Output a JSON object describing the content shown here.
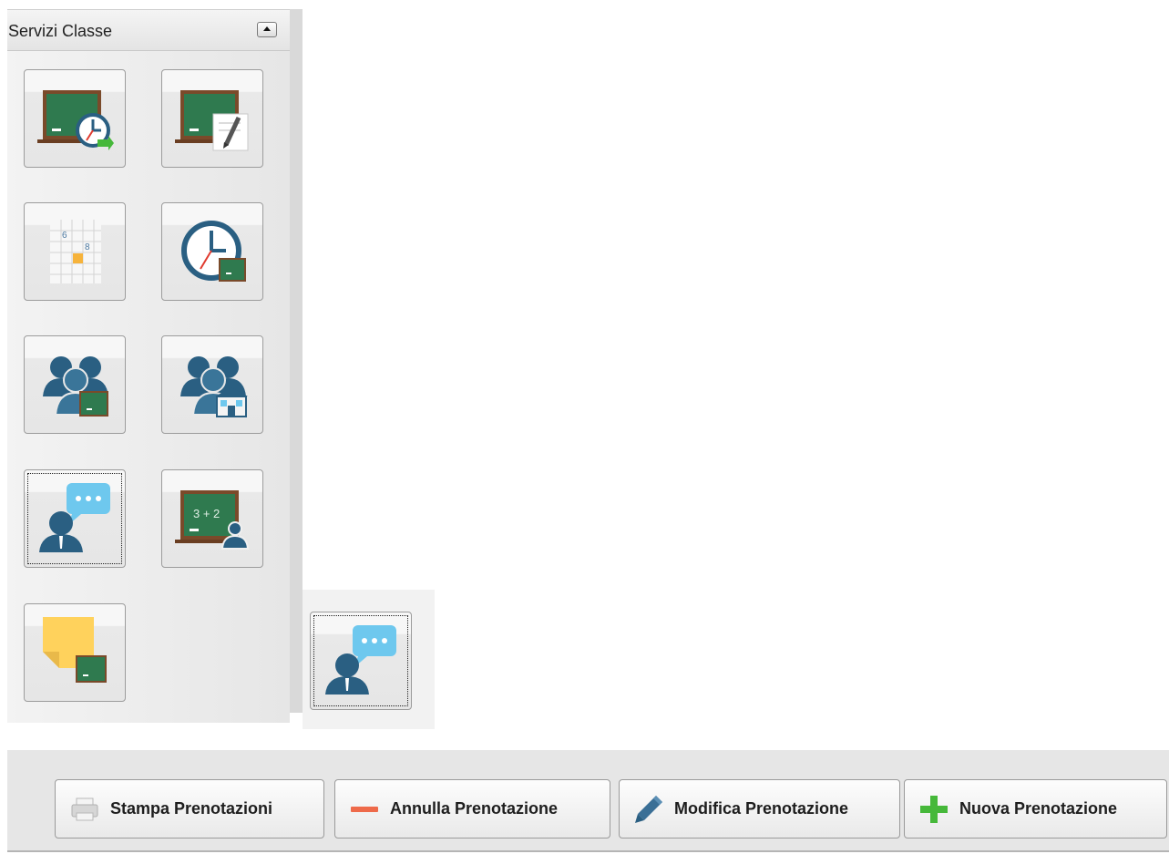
{
  "panel": {
    "title": "Servizi Classe",
    "collapse_icon": "collapse-up-icon",
    "tiles": [
      {
        "icon": "blackboard-clock-icon",
        "focused": false
      },
      {
        "icon": "blackboard-edit-icon",
        "focused": false
      },
      {
        "icon": "timetable-grid-icon",
        "focused": false
      },
      {
        "icon": "clock-blackboard-icon",
        "focused": false
      },
      {
        "icon": "users-blackboard-icon",
        "focused": false
      },
      {
        "icon": "users-school-icon",
        "focused": false
      },
      {
        "icon": "teacher-chat-icon",
        "focused": true
      },
      {
        "icon": "blackboard-teacher-icon",
        "focused": false
      },
      {
        "icon": "sticky-note-blackboard-icon",
        "focused": false
      }
    ]
  },
  "drag_ghost": {
    "icon": "teacher-chat-icon"
  },
  "toolbar": {
    "buttons": [
      {
        "label": "Stampa Prenotazioni",
        "icon": "printer-icon"
      },
      {
        "label": "Annulla Prenotazione",
        "icon": "minus-icon"
      },
      {
        "label": "Modifica Prenotazione",
        "icon": "pencil-icon"
      },
      {
        "label": "Nuova Prenotazione",
        "icon": "plus-icon"
      }
    ]
  },
  "colors": {
    "board_green": "#2f7a4f",
    "board_frame": "#7a4a2a",
    "person_blue": "#2a5f82",
    "bubble_blue": "#6ec8ee",
    "minus_red": "#ee6a4a",
    "plus_green": "#46b83a",
    "note_yellow": "#ffd25c"
  }
}
